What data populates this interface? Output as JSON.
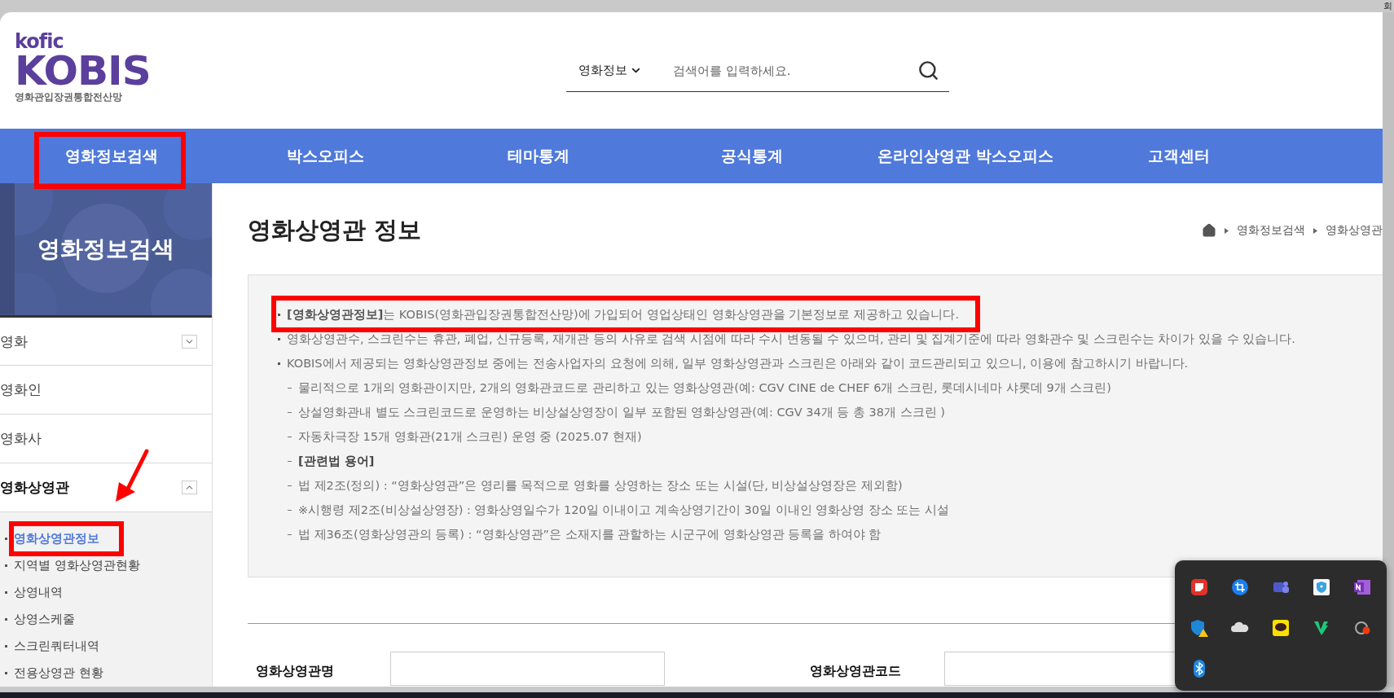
{
  "top_link": "회",
  "logo": {
    "brand": "kofic",
    "name": "KOBIS",
    "tagline": "영화관입장권통합전산망"
  },
  "search": {
    "scope": "영화정보",
    "placeholder": "검색어를 입력하세요."
  },
  "nav": [
    {
      "label": "영화정보검색",
      "highlighted": true
    },
    {
      "label": "박스오피스",
      "highlighted": false
    },
    {
      "label": "테마통계",
      "highlighted": false
    },
    {
      "label": "공식통계",
      "highlighted": false
    },
    {
      "label": "온라인상영관 박스오피스",
      "highlighted": false
    },
    {
      "label": "고객센터",
      "highlighted": false
    }
  ],
  "sidebar": {
    "title": "영화정보검색",
    "arrow_to_submenu": true,
    "items": [
      {
        "label": "영화",
        "expanded": false
      },
      {
        "label": "영화인"
      },
      {
        "label": "영화사"
      },
      {
        "label": "영화상영관",
        "expanded": true,
        "children": [
          {
            "label": "영화상영관정보",
            "selected": true,
            "highlighted": true
          },
          {
            "label": "지역별 영화상영관현황",
            "selected": false,
            "highlighted": false
          },
          {
            "label": "상영내역",
            "selected": false,
            "highlighted": false
          },
          {
            "label": "상영스케줄",
            "selected": false,
            "highlighted": false
          },
          {
            "label": "스크린쿼터내역",
            "selected": false,
            "highlighted": false
          },
          {
            "label": "전용상영관 현황",
            "selected": false,
            "highlighted": false
          }
        ]
      }
    ]
  },
  "page_title": "영화상영관 정보",
  "breadcrumb": [
    "영화정보검색",
    "영화상영관"
  ],
  "notice": [
    {
      "kind": "bullet",
      "text": "**[영화상영관정보]**는 KOBIS(영화관입장권통합전산망)에 가입되어 영업상태인 영화상영관을 기본정보로 제공하고 있습니다.",
      "highlighted": true
    },
    {
      "kind": "bullet",
      "text": "영화상영관수, 스크린수는 휴관, 폐업, 신규등록, 재개관 등의 사유로 검색 시점에 따라 수시 변동될 수 있으며, 관리 및 집계기준에 따라 영화관수 및 스크린수는 차이가 있을 수 있습니다."
    },
    {
      "kind": "bullet",
      "text": "KOBIS에서 제공되는 영화상영관정보 중에는 전송사업자의 요청에 의해, 일부 영화상영관과 스크린은 아래와 같이 코드관리되고 있으니, 이용에 참고하시기 바랍니다."
    },
    {
      "kind": "dash",
      "text": "물리적으로 1개의 영화관이지만, 2개의 영화관코드로 관리하고 있는 영화상영관(예: CGV CINE de CHEF 6개 스크린, 롯데시네마 샤롯데 9개 스크린)"
    },
    {
      "kind": "dash",
      "text": "상설영화관내 별도 스크린코드로 운영하는 비상설상영장이 일부 포함된 영화상영관(예: CGV 34개 등 총 38개 스크린 )"
    },
    {
      "kind": "dash",
      "text": "자동차극장 15개 영화관(21개 스크린) 운영 중 (2025.07 현재)"
    },
    {
      "kind": "dash",
      "text": "[관련법 용어]",
      "emphasis": true
    },
    {
      "kind": "dash",
      "text": "법 제2조(정의) : “영화상영관”은 영리를 목적으로 영화를 상영하는 장소 또는 시설(단, 비상설상영장은 제외함)"
    },
    {
      "kind": "dash",
      "text": "※시행령 제2조(비상설상영장) : 영화상영일수가 120일 이내이고 계속상영기간이 30일 이내인 영화상영 장소 또는 시설"
    },
    {
      "kind": "dash",
      "text": "법 제36조(영화상영관의 등록) : “영화상영관”은 소재지를 관할하는 시군구에 영화상영관 등록을 하여야 함"
    }
  ],
  "form": [
    {
      "label": "영화상영관명"
    },
    {
      "label": "영화상영관코드"
    }
  ]
}
